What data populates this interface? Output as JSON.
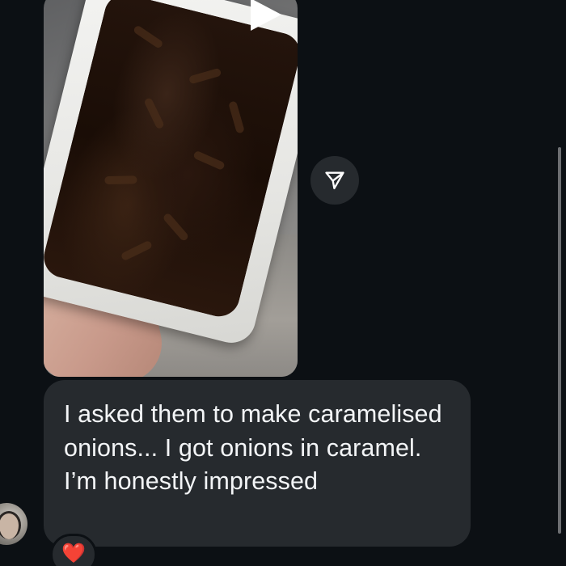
{
  "thread": {
    "media_message": {
      "type": "video",
      "play_icon": "play-icon"
    },
    "share_button": {
      "icon": "paper-plane-icon"
    },
    "message": {
      "text": "I asked them to make caramelised onions... I got onions in caramel. I’m honestly impressed"
    },
    "reaction": {
      "emoji": "❤️",
      "color": "#e8243c"
    },
    "sender": {
      "avatar_icon": "avatar"
    }
  },
  "colors": {
    "background": "#0c1014",
    "bubble": "#262a2e",
    "text": "#f3f5f7"
  }
}
